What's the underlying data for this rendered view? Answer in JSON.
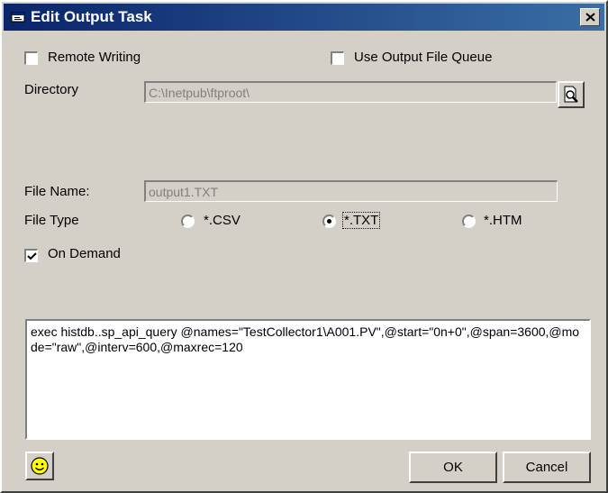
{
  "window": {
    "title": "Edit Output Task"
  },
  "options": {
    "remote_writing": {
      "label": "Remote Writing",
      "checked": false
    },
    "use_output_file_queue": {
      "label": "Use Output File Queue",
      "checked": false
    }
  },
  "directory": {
    "label": "Directory",
    "value": "C:\\Inetpub\\ftproot\\"
  },
  "file_name": {
    "label": "File Name:",
    "value": "output1.TXT"
  },
  "file_type": {
    "label": "File Type",
    "options": [
      {
        "label": "*.CSV",
        "selected": false
      },
      {
        "label": "*.TXT",
        "selected": true
      },
      {
        "label": "*.HTM",
        "selected": false
      }
    ]
  },
  "on_demand": {
    "label": "On Demand",
    "checked": true
  },
  "query": {
    "text": "exec histdb..sp_api_query @names=\"TestCollector1\\A001.PV\",@start=\"0n+0\",@span=3600,@mode=\"raw\",@interv=600,@maxrec=120"
  },
  "buttons": {
    "ok": "OK",
    "cancel": "Cancel"
  },
  "colors": {
    "titlebar_start": "#0a246a",
    "titlebar_end": "#3a6ea5",
    "face": "#d4d0c8",
    "smiley": "#ffff00"
  }
}
